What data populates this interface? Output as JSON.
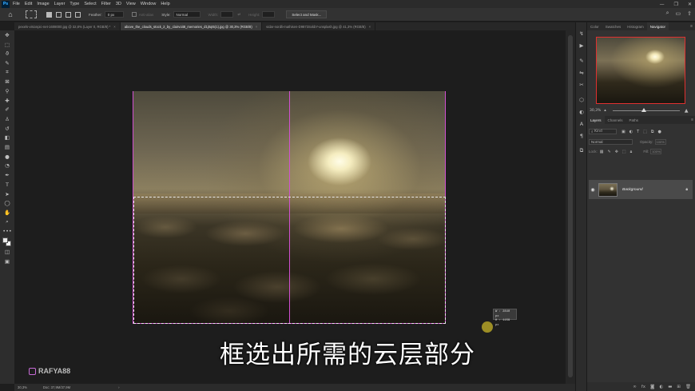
{
  "menubar": {
    "app_icon": "Ps",
    "items": [
      "File",
      "Edit",
      "Image",
      "Layer",
      "Type",
      "Select",
      "Filter",
      "3D",
      "View",
      "Window",
      "Help"
    ],
    "window_controls": [
      "—",
      "❐",
      "✕"
    ]
  },
  "options": {
    "feather_label": "Feather:",
    "feather_value": "0 px",
    "anti_alias_label": "Anti-alias",
    "style_label": "Style:",
    "style_value": "Normal",
    "width_label": "Width:",
    "height_label": "Height:",
    "select_mask_label": "Select and Mask..."
  },
  "tabs": [
    {
      "label": "pexels-visionpic-net-1608000.jpg @ 32,8% (Layer 0, RGB/8) *",
      "active": false
    },
    {
      "label": "above_the_clouds_stock_2_by_clairvoit8_memories_d1j0qt5(1).jpg @ 30,3% (RGB/8)",
      "active": true
    },
    {
      "label": "vidar-nordli-mathisen-D9873SxkbY-unsplash.jpg @ 41,3% (RGB/8)",
      "active": false
    }
  ],
  "canvas": {
    "tooltip_w": "W : 2840 px",
    "tooltip_h": "H : 1159 px"
  },
  "caption": "框选出所需的云层部分",
  "watermark": "RAFYA88",
  "status": {
    "zoom": "30,3%",
    "doc": "Doc: 37,9M/37,9M",
    "arrow": "›"
  },
  "panels": {
    "top_tabs": [
      "Color",
      "Swatches",
      "Histogram",
      "Navigator"
    ],
    "active_top_tab": "Navigator",
    "nav_zoom": "30,3%",
    "layer_tabs": [
      "Layers",
      "Channels",
      "Paths"
    ],
    "filter_kind": "Kind",
    "blend_mode": "Normal",
    "opacity_label": "Opacity:",
    "opacity_value": "100%",
    "lock_label": "Lock:",
    "fill_label": "Fill:",
    "fill_value": "100%",
    "layer_name": "Background"
  },
  "colors": {
    "accent_guide": "#d14fd1",
    "nav_frame": "#e03030"
  }
}
